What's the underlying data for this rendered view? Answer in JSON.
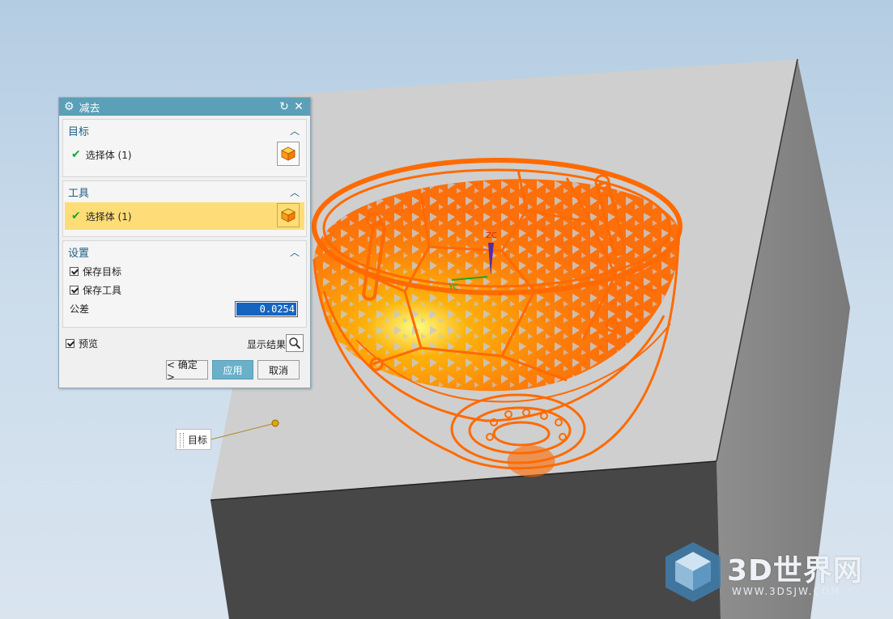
{
  "dialog": {
    "title": "减去",
    "target_section": {
      "heading": "目标",
      "select_label": "选择体 (1)"
    },
    "tool_section": {
      "heading": "工具",
      "select_label": "选择体 (1)"
    },
    "settings_section": {
      "heading": "设置",
      "keep_target_label": "保存目标",
      "keep_tool_label": "保存工具",
      "tolerance_label": "公差",
      "tolerance_value": "0.0254"
    },
    "preview_label": "预览",
    "show_result_label": "显示结果",
    "buttons": {
      "ok": "< 确定 >",
      "apply": "应用",
      "cancel": "取消"
    }
  },
  "viewport": {
    "target_tag": "目标",
    "axis_labels": {
      "zc": "ZC",
      "yc": "YC"
    }
  },
  "watermark": {
    "brand": "3D世界网",
    "url": "WWW.3DSJW.COM"
  },
  "colors": {
    "accent": "#5b9fb8",
    "selection": "#ff6a00",
    "highlight": "#fedd78"
  }
}
